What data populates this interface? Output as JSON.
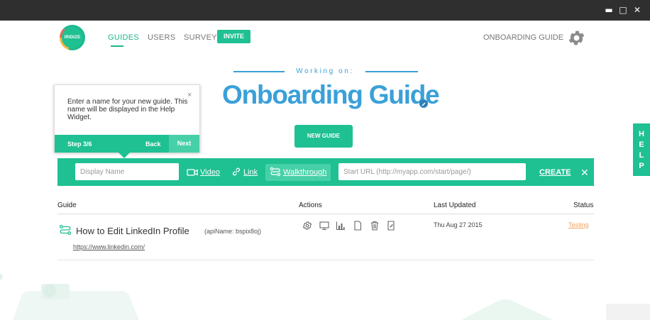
{
  "window_controls": {
    "minimize": "▬",
    "maximize": "□",
    "close": "✕"
  },
  "logo": {
    "text": "IRIDIZE"
  },
  "nav": {
    "guides": "GUIDES",
    "users": "USERS",
    "survey": "SURVEY",
    "invite": "INVITE",
    "onboarding_guide": "ONBOARDING GUIDE",
    "settings_icon": "gear-icon"
  },
  "header": {
    "working_on": "Working on:",
    "title": "Onboarding Guide",
    "edit_icon": "pencil-icon"
  },
  "new_guide_button": "NEW GUIDE",
  "tooltip": {
    "text": "Enter a name for your new guide. This name will be displayed in the Help Widget.",
    "close": "×",
    "step": "Step 3/6",
    "back": "Back",
    "next": "Next"
  },
  "create_bar": {
    "display_name_placeholder": "Display Name",
    "display_name_value": "",
    "types": [
      {
        "label": "Video",
        "icon": "video-icon",
        "selected": false
      },
      {
        "label": "Link",
        "icon": "link-icon",
        "selected": false
      },
      {
        "label": "Walkthrough",
        "icon": "walkthrough-icon",
        "selected": true
      }
    ],
    "start_url_placeholder": "Start URL (http://myapp.com/start/page/)",
    "start_url_value": "",
    "create": "CREATE",
    "close": "✕"
  },
  "table": {
    "columns": [
      "Guide",
      "Actions",
      "Last Updated",
      "Status"
    ],
    "rows": [
      {
        "icon": "walkthrough-icon",
        "name": "How to Edit LinkedIn Profile",
        "api_name": "(apiName: bspix8oj)",
        "url": "https://www.linkedin.com/",
        "actions": [
          "gear-icon",
          "monitor-icon",
          "chart-icon",
          "document-icon",
          "trash-icon",
          "edit-icon"
        ],
        "last_updated": "Thu Aug 27 2015",
        "status": "Testing"
      }
    ]
  },
  "help_tab": [
    "H",
    "E",
    "L",
    "P"
  ],
  "colors": {
    "primary_green": "#1fc092",
    "highlight_green": "#47d0a8",
    "title_blue": "#3aa0d8",
    "status_orange": "#f0a35e",
    "titlebar": "#2f2f2f"
  }
}
